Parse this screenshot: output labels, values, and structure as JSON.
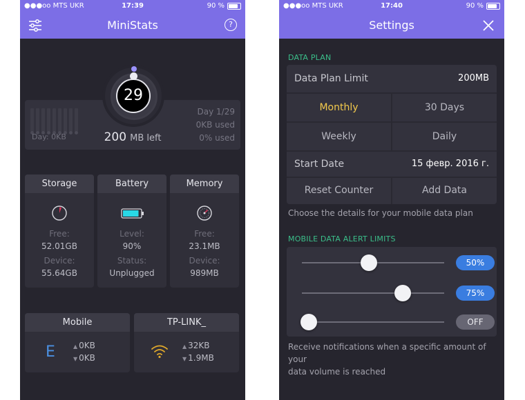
{
  "colors": {
    "accent": "#7c6ee6",
    "green": "#3bbf8a",
    "blue": "#3a7de0",
    "wifi": "#e0a92b"
  },
  "left": {
    "status": {
      "carrier": "●●●oo MTS UKR",
      "time": "17:39",
      "battery": "90 %"
    },
    "title": "MiniStats",
    "help_glyph": "?",
    "day_number": "29",
    "usage": {
      "day_label": "Day: 0KB",
      "left_value": "200",
      "left_unit": "MB left",
      "day_of": "Day 1/29",
      "used_kb": "0KB used",
      "used_pct": "0% used"
    },
    "storage": {
      "header": "Storage",
      "free_label": "Free:",
      "free_value": "52.01GB",
      "device_label": "Device:",
      "device_value": "55.64GB"
    },
    "battery": {
      "header": "Battery",
      "level_label": "Level:",
      "level_value": "90%",
      "status_label": "Status:",
      "status_value": "Unplugged",
      "level_fraction": 0.9
    },
    "memory": {
      "header": "Memory",
      "free_label": "Free:",
      "free_value": "23.1MB",
      "device_label": "Device:",
      "device_value": "989MB"
    },
    "mobile": {
      "header": "Mobile",
      "network_glyph": "E",
      "up": "0KB",
      "down": "0KB"
    },
    "wifi": {
      "header": "TP-LINK_",
      "up": "32KB",
      "down": "1.9MB"
    }
  },
  "right": {
    "status": {
      "carrier": "●●●oo MTS UKR",
      "time": "17:40",
      "battery": "90 %"
    },
    "title": "Settings",
    "data_plan": {
      "section_title": "DATA PLAN",
      "limit_label": "Data Plan Limit",
      "limit_value": "200MB",
      "monthly": "Monthly",
      "thirty_days": "30 Days",
      "weekly": "Weekly",
      "daily": "Daily",
      "start_label": "Start Date",
      "start_value": "15 февр. 2016 г.",
      "reset": "Reset Counter",
      "add": "Add Data",
      "note": "Choose the details for your mobile data plan"
    },
    "alerts": {
      "section_title": "MOBILE DATA ALERT LIMITS",
      "sliders": [
        {
          "value": 0.5,
          "label": "50%",
          "state": "on"
        },
        {
          "value": 0.75,
          "label": "75%",
          "state": "on"
        },
        {
          "value": 0.0,
          "label": "OFF",
          "state": "off"
        }
      ],
      "note_line1": "Receive notifications when a specific amount of your",
      "note_line2": "data volume is reached"
    }
  }
}
